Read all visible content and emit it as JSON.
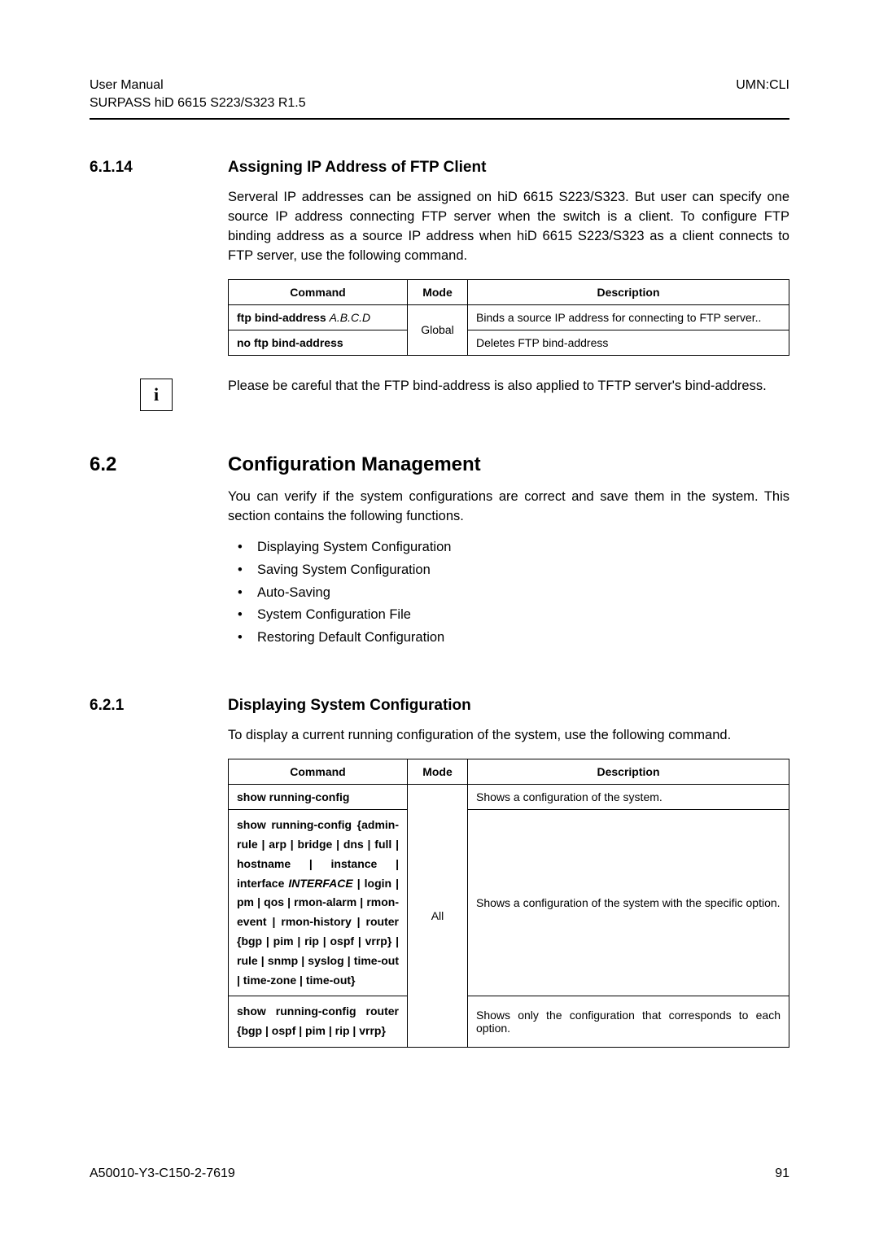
{
  "header": {
    "left_line1": "User Manual",
    "left_line2": "SURPASS hiD 6615 S223/S323 R1.5",
    "right": "UMN:CLI"
  },
  "section_6_1_14": {
    "num": "6.1.14",
    "title": "Assigning IP Address of FTP Client",
    "para": "Serveral IP addresses can be assigned on hiD 6615 S223/S323. But user can specify one source IP address connecting FTP server when the switch is a client. To configure FTP binding address as a source IP address when hiD 6615 S223/S323 as a client connects to FTP server, use the following command.",
    "table": {
      "h1": "Command",
      "h2": "Mode",
      "h3": "Description",
      "r1c1_a": "ftp bind-address ",
      "r1c1_b": "A.B.C.D",
      "mode": "Global",
      "r1c3": "Binds a source IP address for connecting to FTP server..",
      "r2c1": "no ftp bind-address",
      "r2c3": "Deletes FTP bind-address"
    },
    "info_icon": "i",
    "info_text": "Please be careful that the FTP bind-address is also applied to TFTP server's bind-address."
  },
  "section_6_2": {
    "num": "6.2",
    "title": "Configuration Management",
    "para": "You can verify if the system configurations are correct and save them in the system. This section contains the following functions.",
    "bullets": [
      "Displaying System Configuration",
      "Saving System Configuration",
      "Auto-Saving",
      "System Configuration File",
      "Restoring Default Configuration"
    ]
  },
  "section_6_2_1": {
    "num": "6.2.1",
    "title": "Displaying System Configuration",
    "para": "To display a current running configuration of the system, use the following command.",
    "table": {
      "h1": "Command",
      "h2": "Mode",
      "h3": "Description",
      "mode": "All",
      "r1c1": "show running-config",
      "r1c3": "Shows a configuration of the system.",
      "r2c1_pre": "show running-config {admin-rule | arp | bridge | dns | full | hostname | instance | interface ",
      "r2c1_ital": "INTERFACE",
      "r2c1_post": " | login | pm | qos | rmon-alarm | rmon-event | rmon-history | router {bgp | pim | rip | ospf | vrrp} | rule | snmp | syslog | time-out | time-zone | time-out}",
      "r2c3": "Shows a configuration of the system with the specific option.",
      "r3c1": "show running-config router {bgp | ospf | pim | rip | vrrp}",
      "r3c3": "Shows only the configuration that corresponds to each option."
    }
  },
  "footer": {
    "left": "A50010-Y3-C150-2-7619",
    "right": "91"
  },
  "chart_data": {
    "type": "table",
    "tables": [
      {
        "title": "FTP bind-address commands",
        "columns": [
          "Command",
          "Mode",
          "Description"
        ],
        "rows": [
          [
            "ftp bind-address A.B.C.D",
            "Global",
            "Binds a source IP address for connecting to FTP server.."
          ],
          [
            "no ftp bind-address",
            "Global",
            "Deletes FTP bind-address"
          ]
        ]
      },
      {
        "title": "show running-config commands",
        "columns": [
          "Command",
          "Mode",
          "Description"
        ],
        "rows": [
          [
            "show running-config",
            "All",
            "Shows a configuration of the system."
          ],
          [
            "show running-config {admin-rule | arp | bridge | dns | full | hostname | instance | interface INTERFACE | login | pm | qos | rmon-alarm | rmon-event | rmon-history | router {bgp | pim | rip | ospf | vrrp} | rule | snmp | syslog | time-out | time-zone | time-out}",
            "All",
            "Shows a configuration of the system with the specific option."
          ],
          [
            "show running-config router {bgp | ospf | pim | rip | vrrp}",
            "All",
            "Shows only the configuration that corresponds to each option."
          ]
        ]
      }
    ]
  }
}
